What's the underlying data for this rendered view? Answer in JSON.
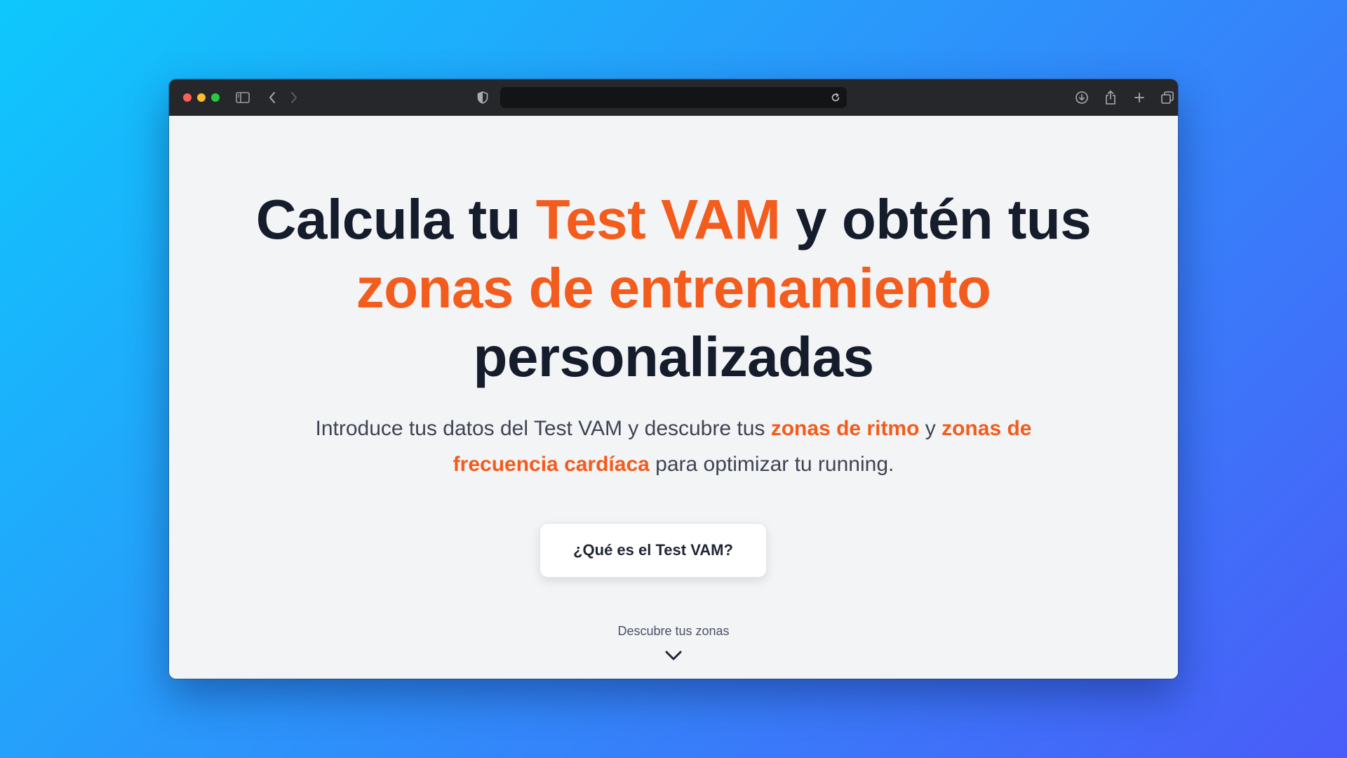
{
  "browser": {
    "url": "",
    "icons": {
      "sidebar": "sidebar-icon",
      "back": "chevron-left-icon",
      "forward": "chevron-right-icon",
      "privacy": "shield-icon",
      "reload": "reload-icon",
      "download": "download-icon",
      "share": "share-icon",
      "new_tab": "plus-icon",
      "tabs": "tabs-overview-icon"
    }
  },
  "hero": {
    "headline": {
      "part1": "Calcula tu ",
      "accent1": "Test VAM",
      "part2": " y obtén tus ",
      "accent2": "zonas de entrenamiento",
      "part3": " personalizadas"
    },
    "subtitle": {
      "part1": "Introduce tus datos del Test VAM y descubre tus ",
      "accent1": "zonas de ritmo",
      "part2": " y ",
      "accent2": "zonas de frecuencia cardíaca",
      "part3": " para optimizar tu running."
    },
    "cta_label": "¿Qué es el Test VAM?",
    "scroll_hint": "Descubre tus zonas"
  },
  "colors": {
    "accent": "#f35c1d",
    "heading": "#151c2c",
    "body_text": "#3e4452",
    "page_bg": "#f3f4f6",
    "titlebar": "#26272b"
  }
}
